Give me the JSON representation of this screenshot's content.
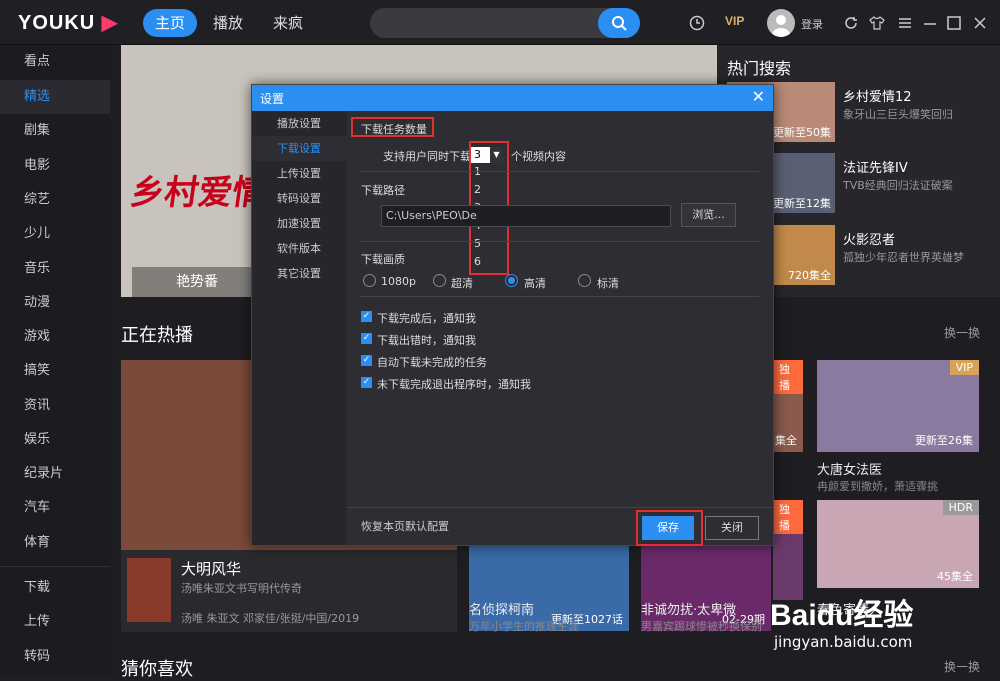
{
  "app": {
    "logo": "YOUKU",
    "brand_color": "#2b8ff2"
  },
  "topnav": {
    "tabs": [
      "主页",
      "播放",
      "来疯"
    ],
    "active": "主页",
    "vip": "VIP",
    "login": "登录"
  },
  "sidebar": {
    "items": [
      "看点",
      "精选",
      "剧集",
      "电影",
      "综艺",
      "少儿",
      "音乐",
      "动漫",
      "游戏",
      "搞笑",
      "资讯",
      "娱乐",
      "纪录片",
      "汽车",
      "体育"
    ],
    "active": "精选",
    "bottom": [
      "下载",
      "上传",
      "转码"
    ]
  },
  "banner": {
    "title": "乡村爱情12",
    "label": "艳势番"
  },
  "hot": {
    "title": "热门搜索",
    "items": [
      {
        "name": "乡村爱情12",
        "desc": "象牙山三巨头爆笑回归",
        "badge": "更新至50集"
      },
      {
        "name": "法证先锋IV",
        "desc": "TVB经典回归法证破案",
        "badge": "更新至12集"
      },
      {
        "name": "火影忍者",
        "desc": "孤独少年忍者世界英雄梦",
        "badge": "720集全"
      }
    ]
  },
  "section1": {
    "title": "正在热播",
    "more": "换一换"
  },
  "section2": {
    "title": "猜你喜欢",
    "more": "换一换"
  },
  "bigcard": {
    "title": "大明风华",
    "desc": "汤唯朱亚文书写明代传奇",
    "meta": "汤唯 朱亚文 邓家佳/张挺/中国/2019"
  },
  "cards": [
    {
      "title": "大唐女法医",
      "desc": "冉颜爱到撒娇，萧适骤挑",
      "tag": "VIP",
      "ep": "更新至26集"
    },
    {
      "title": "名侦探柯南",
      "desc": "万年小学生的推理生涯",
      "tag": "",
      "ep": "更新至1027话"
    },
    {
      "title": "非诚勿扰·太卑微",
      "desc": "男嘉宾踢球惨被秒换保别",
      "tag": "独播",
      "ep": "02-29期"
    },
    {
      "title": "春色寄情人",
      "desc": "",
      "tag": "HDR",
      "ep": "45集全"
    }
  ],
  "partial": {
    "tag1": "独播",
    "ep1": "集全",
    "tag2": "独播"
  },
  "dialog": {
    "title": "设置",
    "close": "✕",
    "nav": [
      "播放设置",
      "下载设置",
      "上传设置",
      "转码设置",
      "加速设置",
      "软件版本",
      "其它设置"
    ],
    "nav_active": "下载设置",
    "task_title": "下载任务数量",
    "task_prefix": "支持用户同时下载",
    "task_value": "3",
    "task_suffix": "个视频内容",
    "task_options": [
      "1",
      "2",
      "3",
      "4",
      "5",
      "6"
    ],
    "path_title": "下载路径",
    "path_value": "C:\\Users\\PEO\\De",
    "browse": "浏览...",
    "quality_title": "下载画质",
    "quality_options": [
      "1080p",
      "超清",
      "高清",
      "标清"
    ],
    "quality_selected": "高清",
    "checks": [
      "下载完成后，通知我",
      "下载出错时，通知我",
      "自动下载未完成的任务",
      "未下载完成退出程序时，通知我"
    ],
    "restore": "恢复本页默认配置",
    "save": "保存",
    "close_btn": "关闭"
  },
  "watermark": {
    "brand": "Baidu经验",
    "url": "jingyan.baidu.com"
  }
}
